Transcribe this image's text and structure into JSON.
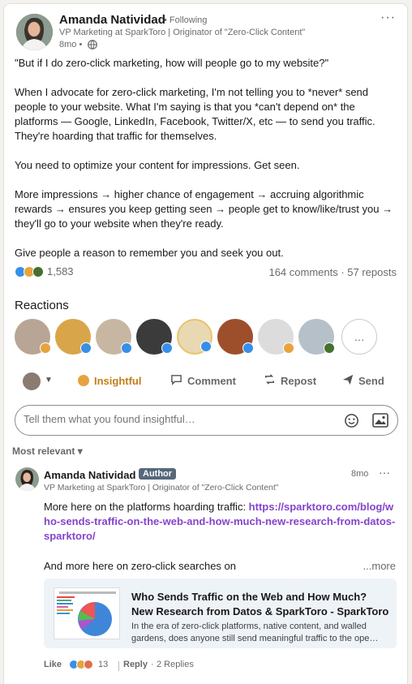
{
  "post": {
    "author_name": "Amanda Natividad",
    "following": "• Following",
    "headline": "VP Marketing at SparkToro | Originator of \"Zero-Click Content\"",
    "time": "8mo •",
    "body": "\"But if I do zero-click marketing, how will people go to my website?\"\n\nWhen I advocate for zero-click marketing, I'm not telling you to *never* send people to your website. What I'm saying is that you *can't depend on* the platforms — Google, LinkedIn, Facebook, Twitter/X, etc — to send you traffic. They're hoarding that traffic for themselves.\n\nYou need to optimize your content for impressions. Get seen.\n\nMore impressions → higher chance of engagement → accruing algorithmic rewards → ensures you keep getting seen → people get to know/like/trust you → they'll go to your website when they're ready.\n\nGive people a reason to remember you and seek you out.",
    "reaction_count": "1,583",
    "comments_reposts": "164 comments · 57 reposts"
  },
  "reactions": {
    "heading": "Reactions",
    "more_label": "…"
  },
  "actions": {
    "insightful": "Insightful",
    "comment": "Comment",
    "repost": "Repost",
    "send": "Send"
  },
  "comment_box": {
    "placeholder": "Tell them what you found insightful…"
  },
  "sort": {
    "label": "Most relevant ▾"
  },
  "comment": {
    "author_name": "Amanda Natividad",
    "author_badge": "Author",
    "headline": "VP Marketing at SparkToro | Originator of \"Zero-Click Content\"",
    "time": "8mo",
    "text_1": "More here on the platforms hoarding traffic: ",
    "link": "https://sparktoro.com/blog/who-sends-traffic-on-the-web-and-how-much-new-research-from-datos-sparktoro/",
    "text_2": "And more here on zero-click searches on",
    "more": "...more",
    "preview_title": "Who Sends Traffic on the Web and How Much? New Research from Datos & SparkToro - SparkToro",
    "preview_desc": "In the era of zero-click platforms, native content, and walled gardens, does anyone still send meaningful traffic to the ope…",
    "like": "Like",
    "reaction_count": "13",
    "reply": "Reply",
    "replies": "2 Replies"
  },
  "colors": {
    "accent_purple": "#8344cc",
    "insightful_orange": "#e7a33e",
    "like_blue": "#378fe9",
    "celebrate_green": "#44712e",
    "love_red": "#df704d"
  }
}
